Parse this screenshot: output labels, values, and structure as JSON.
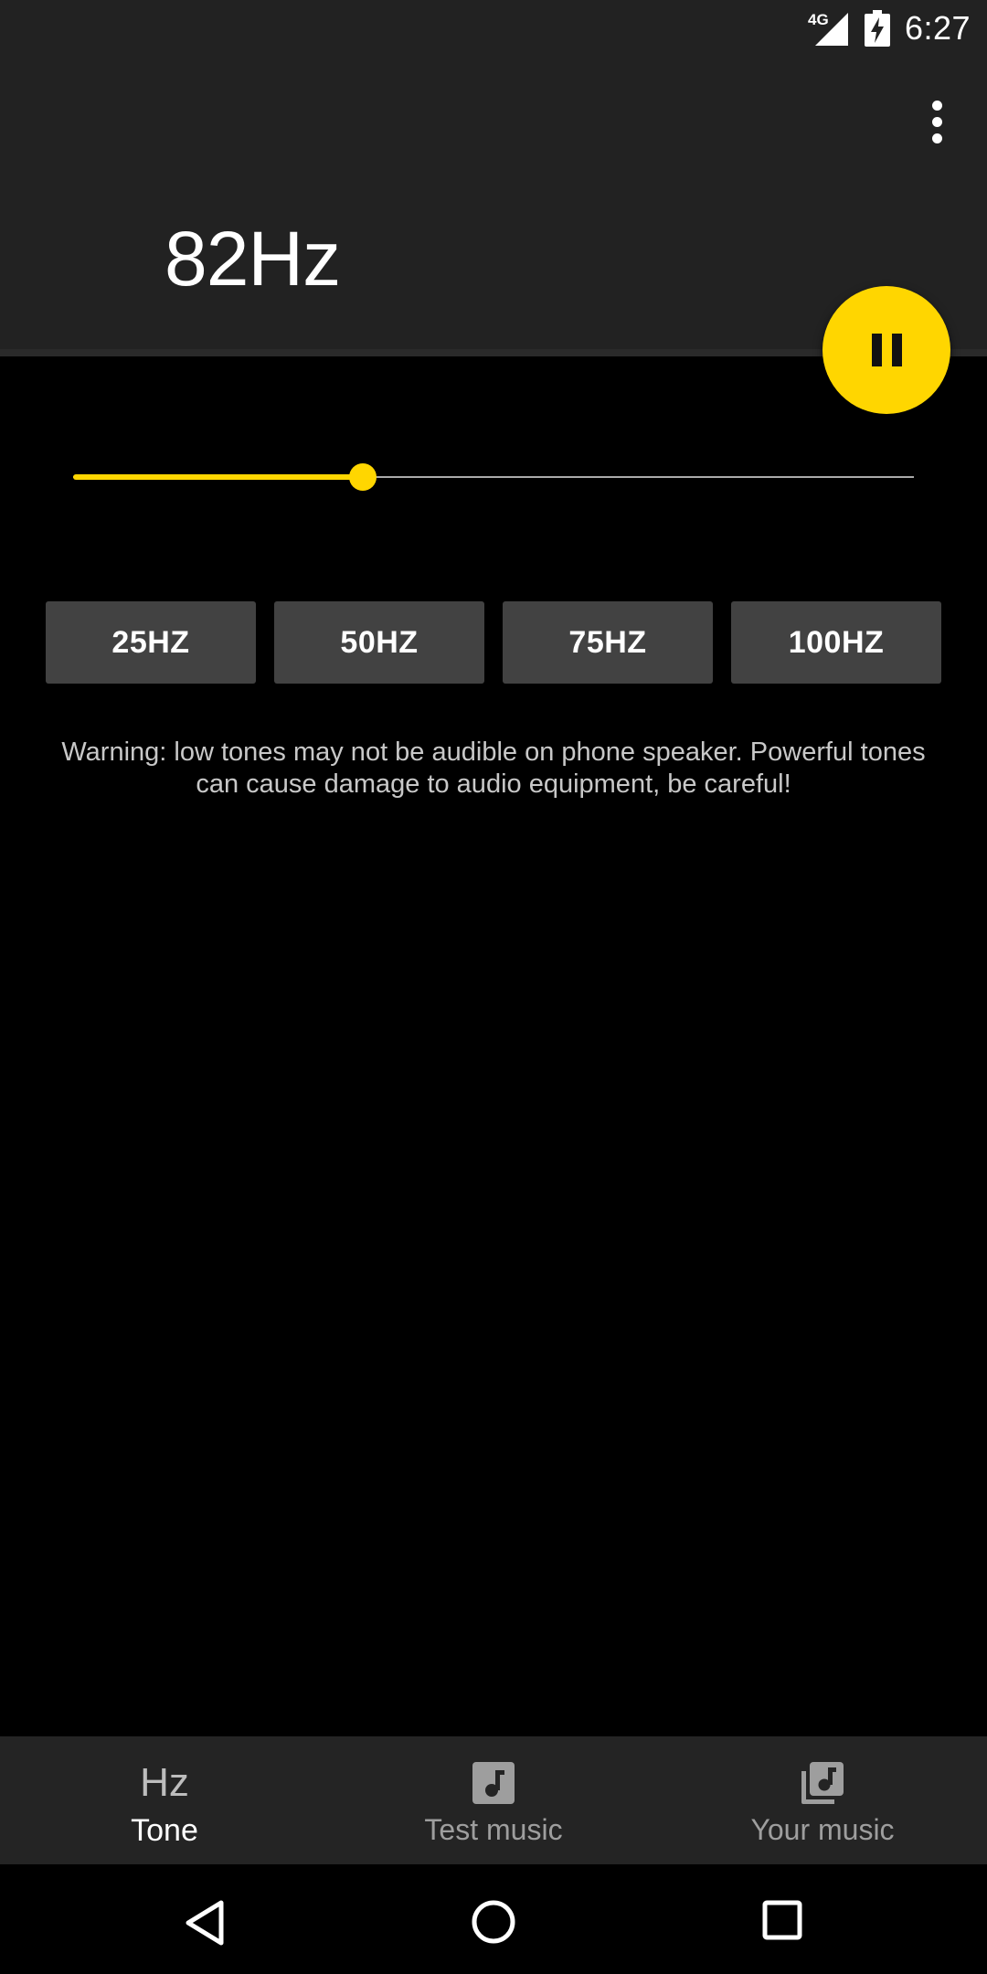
{
  "status_bar": {
    "network": "4G",
    "time": "6:27"
  },
  "app_bar": {
    "frequency_display": "82Hz",
    "overflow_icon": "more-vert-icon"
  },
  "fab": {
    "icon": "pause-icon",
    "color": "#FFD600"
  },
  "slider": {
    "value_fraction": 0.345,
    "accent": "#FFD600"
  },
  "presets": [
    {
      "label": "25HZ"
    },
    {
      "label": "50HZ"
    },
    {
      "label": "75HZ"
    },
    {
      "label": "100HZ"
    }
  ],
  "warning_text": "Warning: low tones may not be audible on phone speaker. Powerful tones can cause damage to audio equipment, be careful!",
  "bottom_nav": {
    "items": [
      {
        "label": "Tone",
        "icon": "Hz",
        "active": true
      },
      {
        "label": "Test music",
        "icon": "music-note-icon",
        "active": false
      },
      {
        "label": "Your music",
        "icon": "library-music-icon",
        "active": false
      }
    ]
  },
  "system_nav": {
    "back": "back-icon",
    "home": "home-icon",
    "recents": "recents-icon"
  }
}
